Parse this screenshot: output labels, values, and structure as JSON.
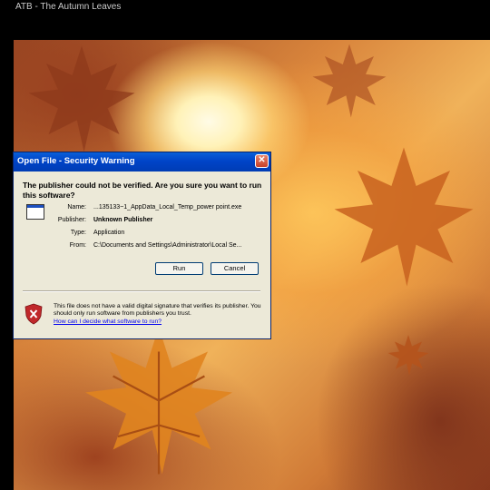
{
  "window": {
    "title": "ATB - The Autumn Leaves"
  },
  "dialog": {
    "title": "Open File - Security Warning",
    "close_icon": "close-icon",
    "warning_text": "The publisher could not be verified.  Are you sure you want to run this software?",
    "fields": [
      {
        "label": "Name:",
        "value": "...135133~1_AppData_Local_Temp_power point.exe",
        "bold": false
      },
      {
        "label": "Publisher:",
        "value": "Unknown Publisher",
        "bold": true
      },
      {
        "label": "Type:",
        "value": "Application",
        "bold": false
      },
      {
        "label": "From:",
        "value": "C:\\Documents and Settings\\Administrator\\Local Se...",
        "bold": false
      }
    ],
    "run_label": "Run",
    "cancel_label": "Cancel",
    "footer_text": "This file does not have a valid digital signature that verifies its publisher.  You should only run software from publishers you trust.",
    "help_link": "How can I decide what software to run?",
    "shield_icon": "shield-warning-icon",
    "file_icon": "application-file-icon"
  },
  "colors": {
    "titlebar": "#0044c8",
    "dialog_bg": "#ece9d8",
    "link": "#0000ee",
    "shield": "#c0282a"
  }
}
